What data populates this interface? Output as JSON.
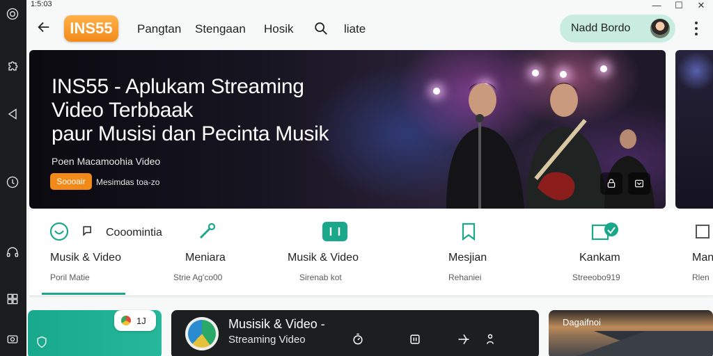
{
  "window": {
    "clock": "1:5:03",
    "controls": {
      "minimize": "—",
      "maximize": "☐",
      "close": "✕"
    }
  },
  "header": {
    "logo": "INS55",
    "nav": [
      "Pangtan",
      "Stengaan",
      "Hosik",
      "liate"
    ],
    "user_name": "Nadd Bordo"
  },
  "hero": {
    "title_line1": "INS55 - Aplukam Streaming",
    "title_line2": "Video Terbbaak",
    "title_line3": "paur Musisi dan Pecinta Musik",
    "subtitle": "Poen Macamoohia Video",
    "cta_label": "Soooair",
    "cta_aside": "Mesimdas toa-zo"
  },
  "categories": {
    "community_label": "Cooomintia",
    "items": [
      {
        "label": "Musik & Video",
        "sub": "Poril Matie"
      },
      {
        "label": "Meniara",
        "sub": "Strie Ag'co00"
      },
      {
        "label": "Musik & Video",
        "sub": "Sirenab kot"
      },
      {
        "label": "Mesjian",
        "sub": "Rehaniei"
      },
      {
        "label": "Kankam",
        "sub": "Streeobo919"
      },
      {
        "label": "Man",
        "sub": "Rlen"
      }
    ],
    "accent_color": "#1aa78a"
  },
  "cards": {
    "green_chip": "1J",
    "dark_title": "Musisik & Video -",
    "dark_sub": "Streaming Video",
    "photo_label": "Dagaifnoi"
  },
  "icons": {
    "rail": [
      "gear-icon",
      "play-left-icon",
      "clock-icon",
      "headset-icon",
      "grid-icon",
      "camera-icon"
    ]
  }
}
